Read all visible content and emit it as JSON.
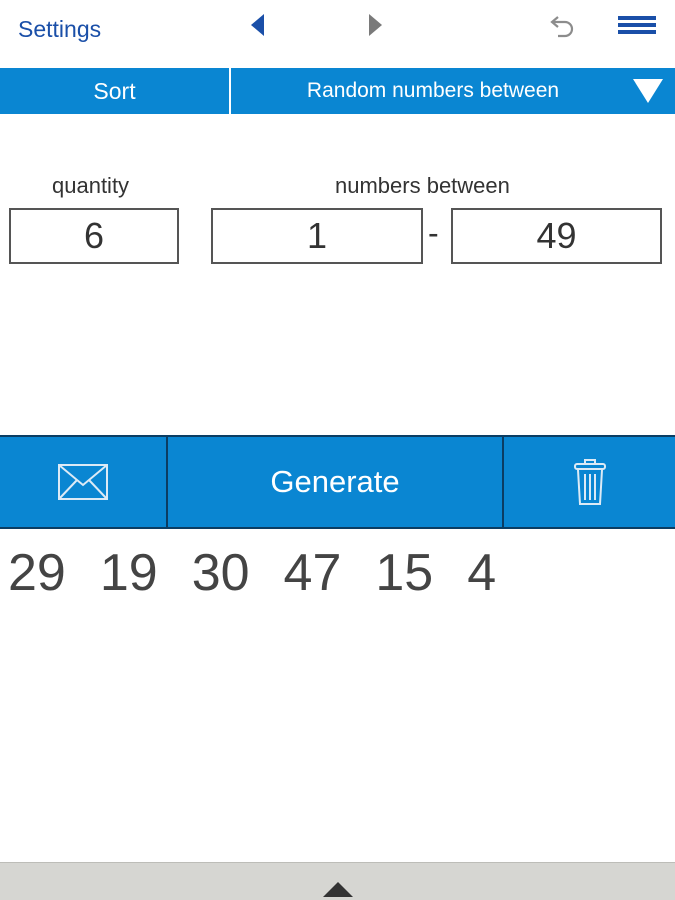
{
  "header": {
    "settings_label": "Settings",
    "prev_icon": "triangle-left-icon",
    "next_icon": "triangle-right-icon",
    "undo_icon": "undo-icon",
    "menu_icon": "menu-icon",
    "accent": "#1a4fa8"
  },
  "modebar": {
    "sort_label": "Sort",
    "mode_label": "Random numbers between",
    "background": "#0a86d2"
  },
  "inputs": {
    "quantity_label": "quantity",
    "range_label": "numbers between",
    "quantity_value": "6",
    "from_value": "1",
    "separator": "-",
    "to_value": "49"
  },
  "actions": {
    "generate_label": "Generate",
    "mail_icon": "mail-icon",
    "trash_icon": "trash-icon"
  },
  "results": [
    "29",
    "19",
    "30",
    "47",
    "15",
    "4"
  ],
  "footer": {
    "expand_icon": "triangle-up-icon"
  }
}
